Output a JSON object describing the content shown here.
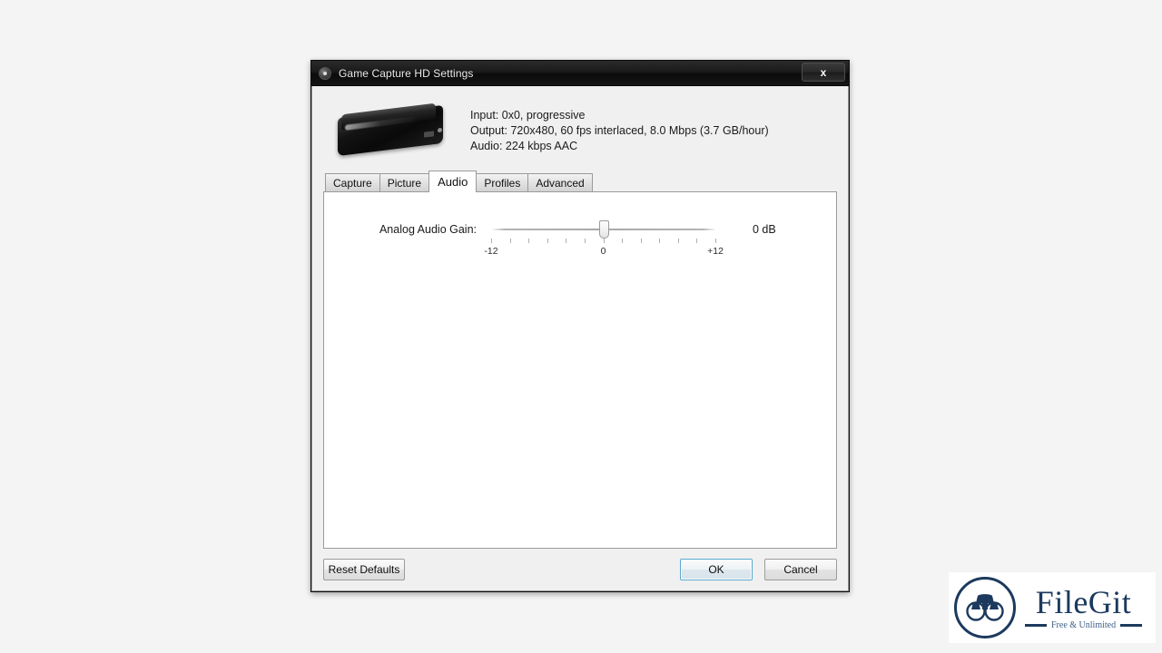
{
  "window": {
    "title": "Game Capture HD Settings",
    "icon": "app-icon",
    "close_label": "x"
  },
  "device": {
    "image_alt": "game-capture-hd-device",
    "info_lines": [
      "Input: 0x0,  progressive",
      "Output: 720x480, 60 fps interlaced, 8.0 Mbps (3.7 GB/hour)",
      "Audio: 224 kbps AAC"
    ]
  },
  "tabs": [
    {
      "label": "Capture",
      "active": false
    },
    {
      "label": "Picture",
      "active": false
    },
    {
      "label": "Audio",
      "active": true
    },
    {
      "label": "Profiles",
      "active": false
    },
    {
      "label": "Advanced",
      "active": false
    }
  ],
  "audio_panel": {
    "gain": {
      "label": "Analog Audio Gain:",
      "value_text": "0 dB",
      "value": 0,
      "min": -12,
      "max": 12,
      "step": 2,
      "tick_count": 13,
      "tick_labels": [
        {
          "text": "-12",
          "position": 0
        },
        {
          "text": "0",
          "position": 50
        },
        {
          "text": "+12",
          "position": 100
        }
      ]
    }
  },
  "footer": {
    "reset_label": "Reset Defaults",
    "ok_label": "OK",
    "cancel_label": "Cancel"
  },
  "watermark": {
    "brand": "FileGit",
    "tagline": "Free & Unlimited",
    "icon": "binoculars-icon",
    "color": "#1c3a5e"
  },
  "colors": {
    "page_background": "#f4f4f4",
    "dialog_background": "#f0f0f0",
    "titlebar": "#131313",
    "panel": "#ffffff",
    "focus_ring": "#5ba7cf",
    "border": "#9a9a9a"
  }
}
